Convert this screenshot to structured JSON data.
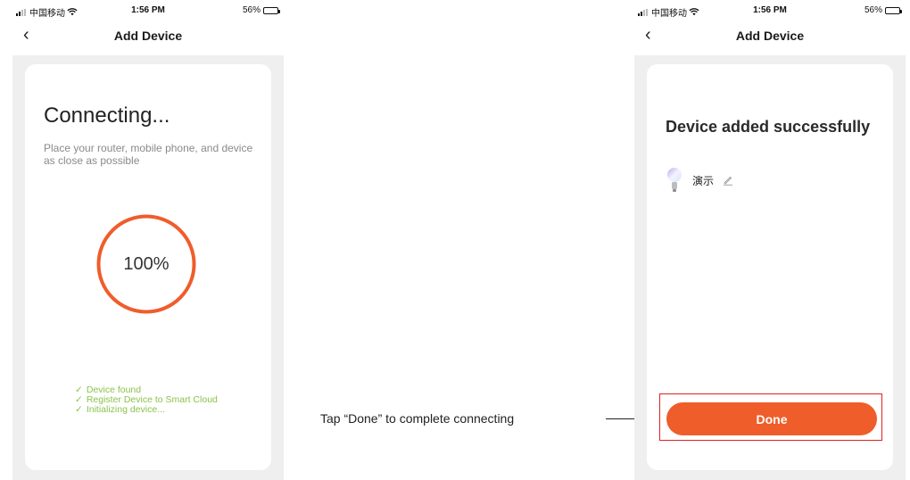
{
  "status_bar": {
    "carrier": "中国移动",
    "time": "1:56 PM",
    "battery_percent": "56%",
    "battery_level": 0.56,
    "wifi_icon": "wifi-icon",
    "signal_icon": "signal-icon"
  },
  "nav": {
    "title": "Add Device",
    "back_icon": "chevron-left-icon"
  },
  "connecting_screen": {
    "heading": "Connecting...",
    "subtext": "Place your router, mobile phone, and device as close as possible",
    "progress_text": "100%",
    "progress_value": 1.0,
    "steps": [
      "Device found",
      "Register Device to Smart Cloud",
      "Initializing device..."
    ],
    "step_icon": "check-icon"
  },
  "success_screen": {
    "heading": "Device added successfully",
    "device_name": "演示",
    "device_icon": "light-bulb-icon",
    "edit_icon": "pencil-icon",
    "done_label": "Done"
  },
  "annotation": {
    "text": "Tap “Done” to complete connecting"
  },
  "colors": {
    "accent": "#ef5d2b",
    "success_green": "#8bc34a",
    "highlight_border": "#e02020",
    "page_background": "#efefef"
  }
}
